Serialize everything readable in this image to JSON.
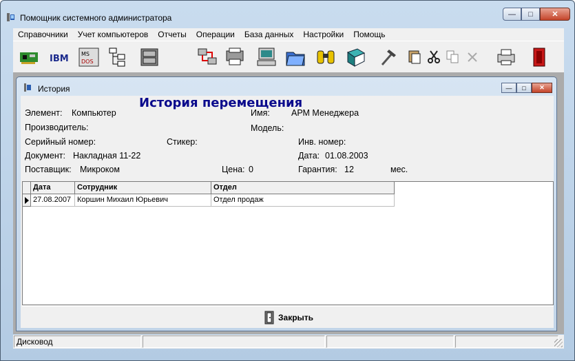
{
  "app": {
    "title": "Помощник системного администратора",
    "window_buttons": {
      "minimize": "—",
      "maximize": "□",
      "close": "✕"
    }
  },
  "menu": [
    "Справочники",
    "Учет компьютеров",
    "Отчеты",
    "Операции",
    "База данных",
    "Настройки",
    "Помощь"
  ],
  "toolbar": {
    "icons": [
      "network-card-icon",
      "ibm-icon",
      "ms-dos-icon",
      "tree-icon",
      "cabinet-icon",
      "network-transfer-icon",
      "printer-device-icon",
      "computer-icon",
      "folder-icon",
      "binoculars-icon",
      "book-icon",
      "hammer-icon",
      "paste-icon",
      "cut-icon",
      "copy-icon",
      "delete-icon",
      "print-icon",
      "exit-icon"
    ],
    "ibm_text": "IBM",
    "msdos_text": "MS DOS"
  },
  "child": {
    "title": "История",
    "heading": "История перемещения",
    "fields": {
      "element_label": "Элемент:",
      "element_value": "Компьютер",
      "name_label": "Имя:",
      "name_value": "АРМ Менеджера",
      "manufacturer_label": "Производитель:",
      "model_label": "Модель:",
      "serial_label": "Серийный номер:",
      "sticker_label": "Стикер:",
      "inv_label": "Инв. номер:",
      "document_label": "Документ:",
      "document_value": "Накладная 11-22",
      "date_label": "Дата:",
      "date_value": "01.08.2003",
      "supplier_label": "Поставщик:",
      "supplier_value": "Микроком",
      "price_label": "Цена:",
      "price_value": "0",
      "warranty_label": "Гарантия:",
      "warranty_value": "12",
      "warranty_unit": "мес."
    },
    "table": {
      "columns": [
        "Дата",
        "Сотрудник",
        "Отдел"
      ],
      "rows": [
        [
          "27.08.2007",
          "Коршин Михаил Юрьевич",
          "Отдел продаж"
        ]
      ]
    },
    "close_button": "Закрыть"
  },
  "status": {
    "cells": [
      "Дисковод",
      "",
      "",
      ""
    ]
  },
  "colors": {
    "heading": "#0a0a8c",
    "accent_close": "#c4442a",
    "chrome": "#c9dcef"
  }
}
